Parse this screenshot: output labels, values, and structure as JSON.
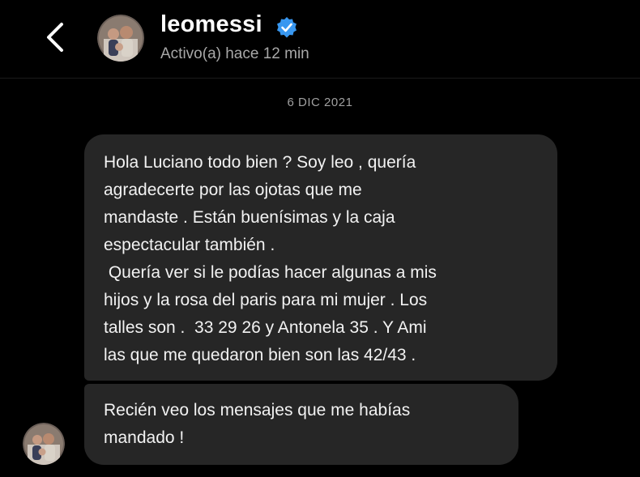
{
  "header": {
    "username": "leomessi",
    "status": "Activo(a) hace 12 min",
    "back_icon": "chevron-left-icon",
    "verified_icon": "verified-badge-icon"
  },
  "thread": {
    "date": "6 DIC 2021",
    "messages": [
      {
        "lines": [
          "Hola Luciano todo bien ? Soy leo , quería",
          "agradecerte por las ojotas que me",
          "mandaste . Están buenísimas y la caja",
          "espectacular también .",
          " Quería ver si le podías hacer algunas a mis",
          "hijos y la rosa del paris para mi mujer . Los",
          "talles son .  33 29 26 y Antonela 35 . Y Ami",
          "las que me quedaron bien son las 42/43 ."
        ]
      },
      {
        "lines": [
          "Recién veo los mensajes que me habías",
          "mandado !"
        ]
      }
    ]
  },
  "colors": {
    "background": "#000000",
    "bubble": "#262626",
    "verified": "#3897f0",
    "secondary_text": "#a8a8a8"
  }
}
